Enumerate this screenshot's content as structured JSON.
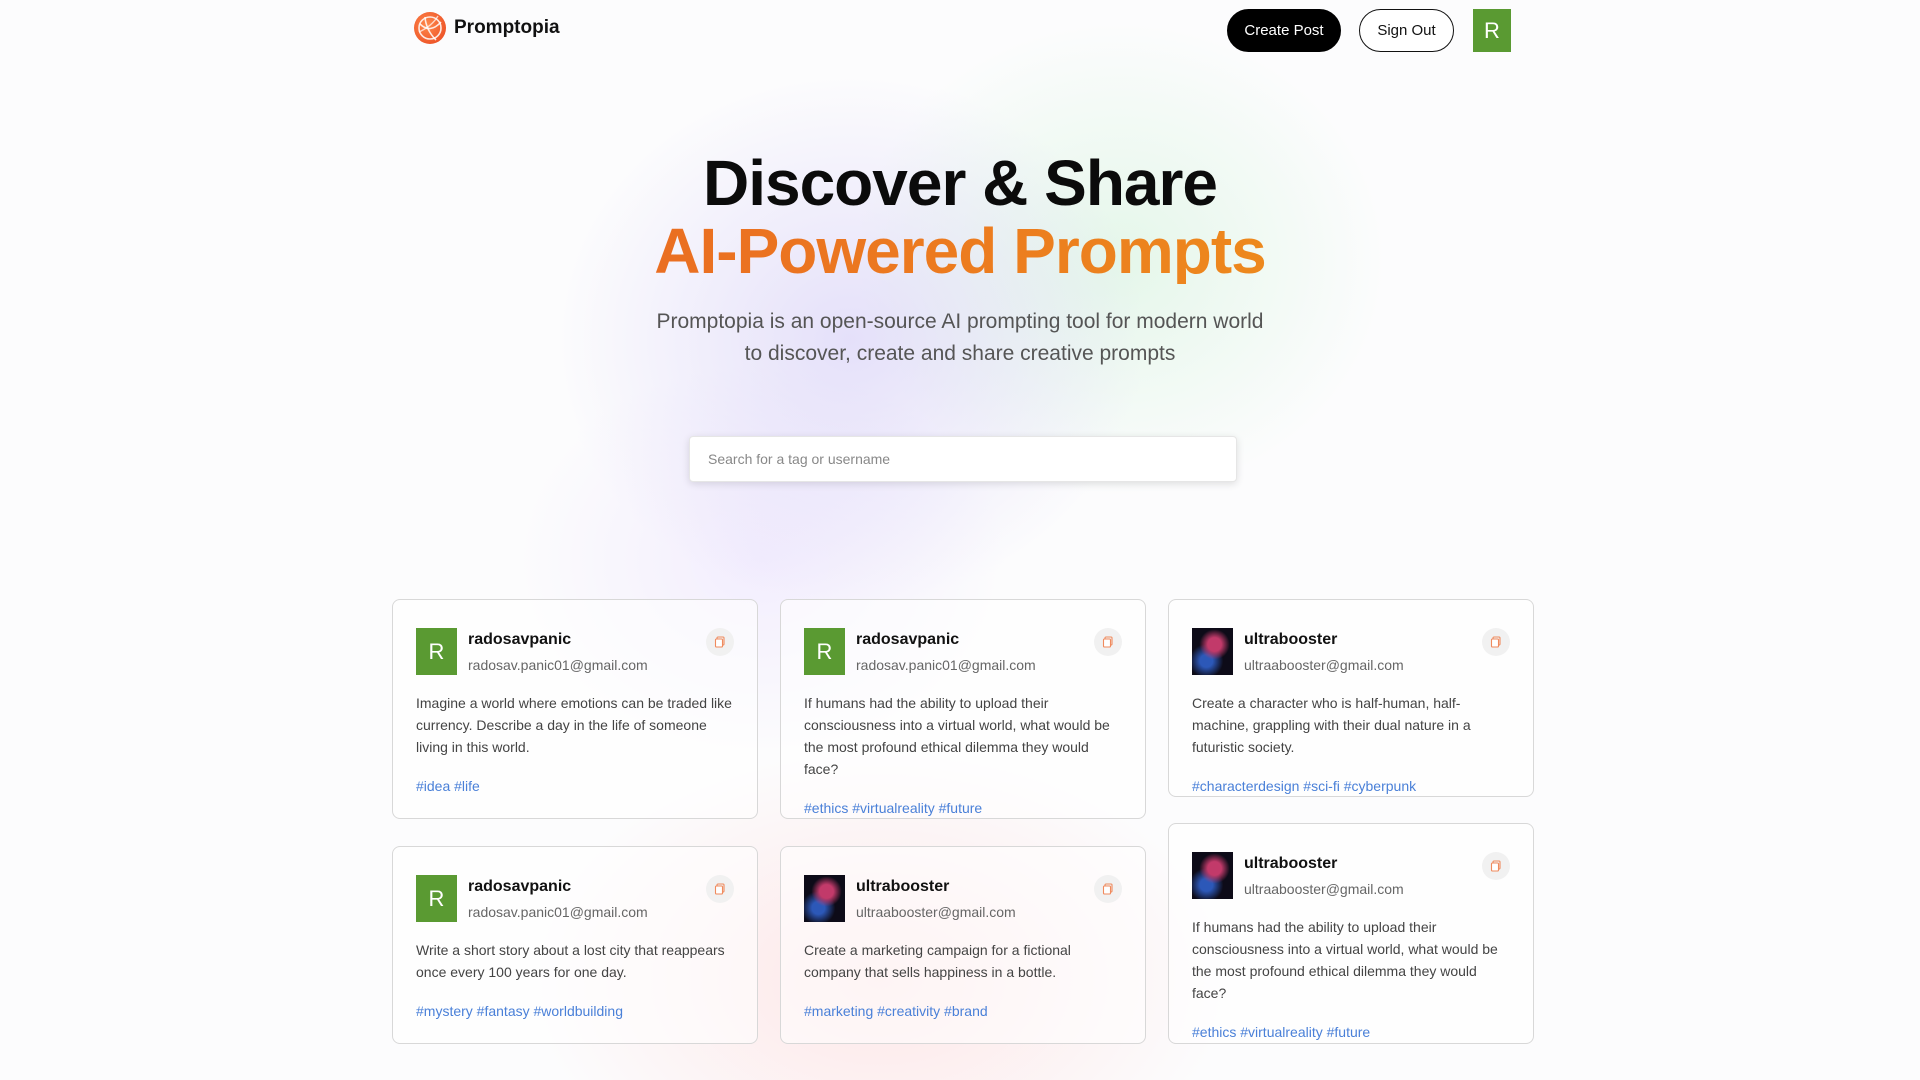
{
  "nav": {
    "brand": "Promptopia",
    "create_label": "Create Post",
    "signout_label": "Sign Out",
    "avatar_letter": "R"
  },
  "hero": {
    "line1": "Discover & Share",
    "line2": "AI-Powered Prompts",
    "description": "Promptopia is an open-source AI prompting tool for modern world to discover, create and share creative prompts"
  },
  "search": {
    "placeholder": "Search for a tag or username"
  },
  "colors": {
    "accent_orange": "#ea6b22",
    "tag_blue": "#4a80d8",
    "avatar_green": "#5a9a32"
  },
  "cards": [
    {
      "avatar": "R",
      "username": "radosavpanic",
      "email": "radosav.panic01@gmail.com",
      "prompt": "Imagine a world where emotions can be traded like currency. Describe a day in the life of someone living in this world.",
      "tags": "#idea #life"
    },
    {
      "avatar": "R",
      "username": "radosavpanic",
      "email": "radosav.panic01@gmail.com",
      "prompt": "If humans had the ability to upload their consciousness into a virtual world, what would be the most profound ethical dilemma they would face?",
      "tags": "#ethics #virtualreality #future"
    },
    {
      "avatar": "",
      "username": "ultrabooster",
      "email": "ultraabooster@gmail.com",
      "prompt": "Create a character who is half-human, half-machine, grappling with their dual nature in a futuristic society.",
      "tags": "#characterdesign #sci-fi #cyberpunk"
    },
    {
      "avatar": "R",
      "username": "radosavpanic",
      "email": "radosav.panic01@gmail.com",
      "prompt": "Write a short story about a lost city that reappears once every 100 years for one day.",
      "tags": "#mystery #fantasy #worldbuilding"
    },
    {
      "avatar": "",
      "username": "ultrabooster",
      "email": "ultraabooster@gmail.com",
      "prompt": "Create a marketing campaign for a fictional company that sells happiness in a bottle.",
      "tags": "#marketing #creativity #brand"
    },
    {
      "avatar": "",
      "username": "ultrabooster",
      "email": "ultraabooster@gmail.com",
      "prompt": "If humans had the ability to upload their consciousness into a virtual world, what would be the most profound ethical dilemma they would face?",
      "tags": "#ethics #virtualreality #future"
    }
  ]
}
